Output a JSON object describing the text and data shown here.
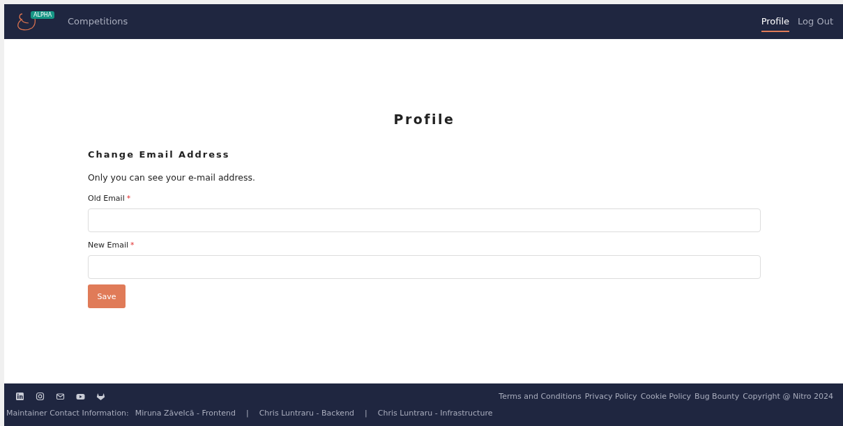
{
  "navbar": {
    "badge": "ALPHA",
    "links": [
      {
        "label": "Competitions",
        "selected": false
      }
    ],
    "right_links": [
      {
        "label": "Profile",
        "selected": true
      },
      {
        "label": "Log Out",
        "selected": false
      }
    ]
  },
  "page": {
    "title": "Profile",
    "section_title": "Change Email Address",
    "description": "Only you can see your e-mail address.",
    "fields": [
      {
        "label": "Old Email",
        "required_mark": "*"
      },
      {
        "label": "New Email",
        "required_mark": "*"
      }
    ],
    "save_button": "Save"
  },
  "footer": {
    "social_icons": [
      {
        "kind": "linkedin"
      },
      {
        "kind": "instagram"
      },
      {
        "kind": "mail"
      },
      {
        "kind": "youtube"
      },
      {
        "kind": "gitlab"
      }
    ],
    "links": [
      "Terms and Conditions",
      "Privacy Policy",
      "Cookie Policy",
      "Bug Bounty"
    ],
    "copyright": "Copyright @ Nitro 2024",
    "contact_label": "Maintainer Contact Information:",
    "contacts": [
      {
        "text": "Miruna Zăvelcă - Frontend"
      },
      {
        "separator": "|",
        "text": "Chris Luntraru - Backend"
      },
      {
        "separator": "|",
        "text": "Chris Luntraru - Infrastructure"
      }
    ]
  }
}
